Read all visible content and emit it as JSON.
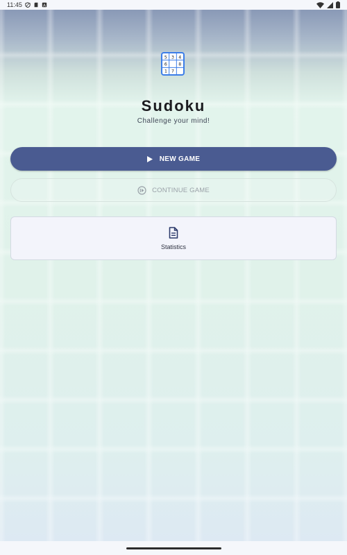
{
  "status_bar": {
    "time": "11:45",
    "icons_left": [
      "privacy-shield-icon",
      "sim-card-icon",
      "notification-a-icon"
    ],
    "icons_right": [
      "wifi-icon",
      "cellular-signal-icon",
      "battery-icon"
    ]
  },
  "logo": {
    "grid": [
      [
        "5",
        "3",
        "4"
      ],
      [
        "6",
        "",
        "8"
      ],
      [
        "1",
        "7",
        ""
      ]
    ],
    "border_color": "#3b7de8"
  },
  "app": {
    "title": "Sudoku",
    "subtitle": "Challenge your mind!"
  },
  "actions": {
    "new_game_label": "NEW GAME",
    "continue_label": "CONTINUE GAME",
    "continue_enabled": false
  },
  "cards": {
    "statistics_label": "Statistics"
  },
  "colors": {
    "primary": "#4a5b91",
    "disabled_text": "#9aa1a8",
    "card_bg": "#f3f4fb"
  }
}
